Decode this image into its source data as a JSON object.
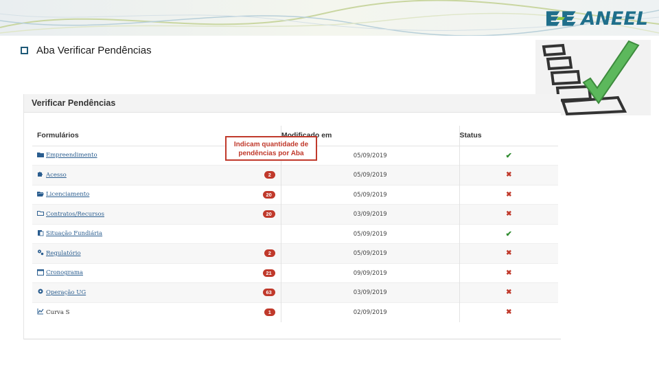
{
  "slide": {
    "heading": "Aba Verificar Pendências",
    "logo_text": "ANEEL",
    "colors": {
      "logo": "#1f6f8b",
      "badge": "#c0392b",
      "ok": "#2e8b2e",
      "error": "#c0392b",
      "link": "#2a5d8f"
    }
  },
  "panel": {
    "title": "Verificar Pendências",
    "columns": {
      "form": "Formulários",
      "modified": "Modificado em",
      "status": "Status"
    },
    "callout": "Indicam quantidade de pendências por Aba",
    "rows": [
      {
        "icon": "folder-icon",
        "label": "Empreendimento",
        "badge": "",
        "date": "05/09/2019",
        "status": "ok"
      },
      {
        "icon": "puzzle-icon",
        "label": "Acesso",
        "badge": "2",
        "date": "05/09/2019",
        "status": "error"
      },
      {
        "icon": "folder-open-icon",
        "label": "Licenciamento",
        "badge": "20",
        "date": "05/09/2019",
        "status": "error"
      },
      {
        "icon": "folder-outline-icon",
        "label": "Contratos/Recursos",
        "badge": "20",
        "date": "03/09/2019",
        "status": "error"
      },
      {
        "icon": "document-icon",
        "label": "Situação Fundiária",
        "badge": "",
        "date": "05/09/2019",
        "status": "ok"
      },
      {
        "icon": "cogs-icon",
        "label": "Regulatório",
        "badge": "2",
        "date": "05/09/2019",
        "status": "error"
      },
      {
        "icon": "calendar-icon",
        "label": "Cronograma",
        "badge": "21",
        "date": "09/09/2019",
        "status": "error"
      },
      {
        "icon": "gear-icon",
        "label": "Operação UG",
        "badge": "63",
        "date": "03/09/2019",
        "status": "error"
      },
      {
        "icon": "chart-line-icon",
        "label": "Curva S",
        "badge": "1",
        "date": "02/09/2019",
        "status": "error"
      }
    ],
    "status_glyphs": {
      "ok": "✔",
      "error": "✖"
    }
  }
}
